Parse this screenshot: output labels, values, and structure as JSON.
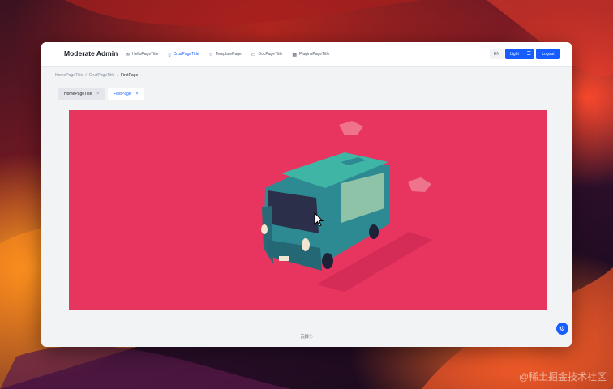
{
  "app": {
    "title": "Moderate Admin"
  },
  "nav": {
    "items": [
      {
        "label": "HelloPageTitle",
        "icon": "message-icon"
      },
      {
        "label": "CrudPageTitle",
        "icon": "document-icon",
        "active": true
      },
      {
        "label": "TemplatePage",
        "icon": "star-icon"
      },
      {
        "label": "DocPageTitle",
        "icon": "book-icon"
      },
      {
        "label": "PluginsPageTitle",
        "icon": "grid-icon"
      }
    ]
  },
  "header": {
    "lang_label": "EN",
    "theme_label": "Light",
    "logout_label": "Logout"
  },
  "breadcrumb": {
    "items": [
      "HomePageTitle",
      "CrudPageTitle",
      "FirstPage"
    ],
    "separator": "/"
  },
  "tabs": [
    {
      "label": "HomePageTitle",
      "close": "×"
    },
    {
      "label": "FirstPage",
      "close": "×",
      "active": true
    }
  ],
  "footer": {
    "text": "页脚①"
  },
  "colors": {
    "accent": "#165dff",
    "content_bg": "#e8355f"
  },
  "watermark": "@稀土掘金技术社区"
}
